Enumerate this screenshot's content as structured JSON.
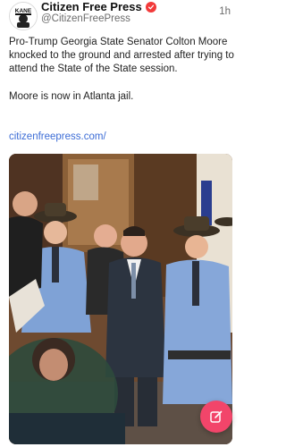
{
  "post": {
    "author": {
      "display_name": "Citizen Free Press",
      "handle": "@CitizenFreePress",
      "avatar_text": "KANE",
      "verified": true,
      "verified_color": "#f23a3a"
    },
    "timestamp": "1h",
    "paragraphs": [
      "Pro-Trump Georgia State Senator Colton Moore knocked to the ground and arrested after trying to attend the State of the State session.",
      "Moore is now in Atlanta jail."
    ],
    "link": "citizenfreepress.com/",
    "link_color": "#3d6dd6",
    "media": {
      "type": "photo",
      "subject": "state-troopers-arrest-scene"
    }
  },
  "fab": {
    "icon": "compose-icon",
    "color": "#f2456a"
  }
}
